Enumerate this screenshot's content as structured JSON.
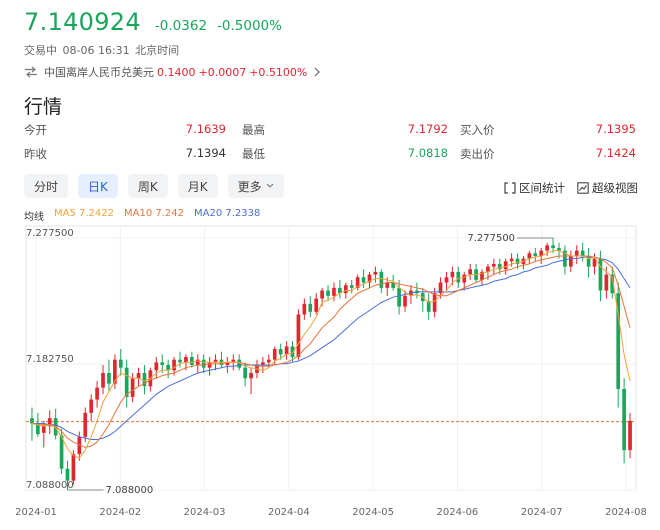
{
  "quote": {
    "price": "7.140924",
    "change": "-0.0362",
    "change_pct": "-0.5000%",
    "status": "交易中",
    "datetime": "08-06 16:31",
    "timezone": "北京时间"
  },
  "related": {
    "name": "中国离岸人民币兑美元",
    "price": "0.1400",
    "change": "+0.0007",
    "change_pct": "+0.5100%"
  },
  "section_title": "行情",
  "stats": [
    [
      {
        "label": "今开",
        "value": "7.1639",
        "color": "red"
      },
      {
        "label": "最高",
        "value": "7.1792",
        "color": "red"
      },
      {
        "label": "买入价",
        "value": "7.1395",
        "color": "red"
      }
    ],
    [
      {
        "label": "昨收",
        "value": "7.1394",
        "color": "plain"
      },
      {
        "label": "最低",
        "value": "7.0818",
        "color": "green"
      },
      {
        "label": "卖出价",
        "value": "7.1424",
        "color": "red"
      }
    ]
  ],
  "tabs": [
    {
      "label": "分时",
      "active": false
    },
    {
      "label": "日K",
      "active": true
    },
    {
      "label": "周K",
      "active": false
    },
    {
      "label": "月K",
      "active": false
    },
    {
      "label": "更多",
      "active": false
    }
  ],
  "tools": {
    "range_stats": "区间统计",
    "super_view": "超级视图"
  },
  "ma": {
    "label": "均线",
    "ma5": "MA5 7.2422",
    "ma10": "MA10 7.242",
    "ma20": "MA20 7.2338"
  },
  "colors": {
    "up": "#e0262e",
    "down": "#1aa65a",
    "ma5": "#f3a33b",
    "ma10": "#e8743b",
    "ma20": "#4c6fd9",
    "prev_close_line": "#e8743b"
  },
  "chart_data": {
    "type": "candlestick",
    "y_ticks": [
      "7.277500",
      "7.182750",
      "7.088000"
    ],
    "ylim": [
      7.088,
      7.2775
    ],
    "x_ticks": [
      "2024-01",
      "2024-02",
      "2024-03",
      "2024-04",
      "2024-05",
      "2024-06",
      "2024-07",
      "2024-08"
    ],
    "max_annotation": "7.277500",
    "min_annotation": "7.088000",
    "prev_close": 7.1394,
    "candles": [
      [
        7.142,
        7.15,
        7.125,
        7.138
      ],
      [
        7.138,
        7.146,
        7.128,
        7.13
      ],
      [
        7.131,
        7.14,
        7.12,
        7.136
      ],
      [
        7.136,
        7.148,
        7.13,
        7.142
      ],
      [
        7.142,
        7.149,
        7.126,
        7.129
      ],
      [
        7.129,
        7.134,
        7.1,
        7.104
      ],
      [
        7.104,
        7.11,
        7.088,
        7.095
      ],
      [
        7.095,
        7.118,
        7.092,
        7.115
      ],
      [
        7.115,
        7.132,
        7.11,
        7.128
      ],
      [
        7.128,
        7.15,
        7.124,
        7.146
      ],
      [
        7.146,
        7.16,
        7.14,
        7.156
      ],
      [
        7.156,
        7.17,
        7.15,
        7.165
      ],
      [
        7.165,
        7.182,
        7.16,
        7.176
      ],
      [
        7.176,
        7.186,
        7.162,
        7.168
      ],
      [
        7.168,
        7.19,
        7.164,
        7.186
      ],
      [
        7.186,
        7.194,
        7.174,
        7.18
      ],
      [
        7.18,
        7.186,
        7.15,
        7.158
      ],
      [
        7.158,
        7.176,
        7.154,
        7.172
      ],
      [
        7.172,
        7.18,
        7.166,
        7.176
      ],
      [
        7.176,
        7.182,
        7.16,
        7.166
      ],
      [
        7.166,
        7.18,
        7.162,
        7.178
      ],
      [
        7.178,
        7.188,
        7.172,
        7.184
      ],
      [
        7.184,
        7.19,
        7.176,
        7.182
      ],
      [
        7.182,
        7.186,
        7.172,
        7.178
      ],
      [
        7.178,
        7.188,
        7.174,
        7.186
      ],
      [
        7.186,
        7.192,
        7.18,
        7.184
      ],
      [
        7.184,
        7.19,
        7.178,
        7.188
      ],
      [
        7.188,
        7.192,
        7.18,
        7.182
      ],
      [
        7.182,
        7.19,
        7.176,
        7.186
      ],
      [
        7.186,
        7.19,
        7.176,
        7.18
      ],
      [
        7.18,
        7.188,
        7.174,
        7.184
      ],
      [
        7.184,
        7.19,
        7.178,
        7.186
      ],
      [
        7.186,
        7.192,
        7.18,
        7.182
      ],
      [
        7.182,
        7.188,
        7.176,
        7.184
      ],
      [
        7.184,
        7.19,
        7.178,
        7.186
      ],
      [
        7.186,
        7.19,
        7.178,
        7.18
      ],
      [
        7.18,
        7.184,
        7.166,
        7.172
      ],
      [
        7.172,
        7.18,
        7.16,
        7.176
      ],
      [
        7.176,
        7.186,
        7.172,
        7.182
      ],
      [
        7.182,
        7.188,
        7.176,
        7.184
      ],
      [
        7.184,
        7.19,
        7.18,
        7.186
      ],
      [
        7.186,
        7.196,
        7.182,
        7.194
      ],
      [
        7.194,
        7.198,
        7.186,
        7.19
      ],
      [
        7.19,
        7.2,
        7.186,
        7.196
      ],
      [
        7.196,
        7.2,
        7.184,
        7.188
      ],
      [
        7.188,
        7.224,
        7.186,
        7.22
      ],
      [
        7.22,
        7.232,
        7.216,
        7.228
      ],
      [
        7.228,
        7.234,
        7.218,
        7.222
      ],
      [
        7.222,
        7.236,
        7.22,
        7.232
      ],
      [
        7.232,
        7.24,
        7.226,
        7.238
      ],
      [
        7.238,
        7.242,
        7.23,
        7.234
      ],
      [
        7.234,
        7.244,
        7.23,
        7.24
      ],
      [
        7.24,
        7.246,
        7.232,
        7.236
      ],
      [
        7.236,
        7.244,
        7.232,
        7.242
      ],
      [
        7.242,
        7.246,
        7.236,
        7.24
      ],
      [
        7.24,
        7.25,
        7.238,
        7.248
      ],
      [
        7.248,
        7.254,
        7.24,
        7.244
      ],
      [
        7.244,
        7.252,
        7.24,
        7.25
      ],
      [
        7.25,
        7.256,
        7.244,
        7.252
      ],
      [
        7.252,
        7.254,
        7.236,
        7.24
      ],
      [
        7.24,
        7.248,
        7.234,
        7.244
      ],
      [
        7.244,
        7.25,
        7.238,
        7.24
      ],
      [
        7.24,
        7.246,
        7.22,
        7.226
      ],
      [
        7.226,
        7.238,
        7.222,
        7.234
      ],
      [
        7.234,
        7.242,
        7.228,
        7.238
      ],
      [
        7.238,
        7.244,
        7.232,
        7.236
      ],
      [
        7.236,
        7.24,
        7.222,
        7.23
      ],
      [
        7.23,
        7.236,
        7.216,
        7.222
      ],
      [
        7.222,
        7.24,
        7.218,
        7.236
      ],
      [
        7.236,
        7.248,
        7.232,
        7.244
      ],
      [
        7.244,
        7.252,
        7.238,
        7.248
      ],
      [
        7.248,
        7.256,
        7.242,
        7.252
      ],
      [
        7.252,
        7.256,
        7.24,
        7.244
      ],
      [
        7.244,
        7.252,
        7.238,
        7.25
      ],
      [
        7.25,
        7.258,
        7.246,
        7.254
      ],
      [
        7.254,
        7.258,
        7.244,
        7.246
      ],
      [
        7.246,
        7.254,
        7.242,
        7.252
      ],
      [
        7.252,
        7.258,
        7.246,
        7.256
      ],
      [
        7.256,
        7.262,
        7.25,
        7.258
      ],
      [
        7.258,
        7.262,
        7.25,
        7.254
      ],
      [
        7.254,
        7.262,
        7.25,
        7.26
      ],
      [
        7.26,
        7.266,
        7.256,
        7.262
      ],
      [
        7.262,
        7.266,
        7.254,
        7.258
      ],
      [
        7.258,
        7.264,
        7.254,
        7.262
      ],
      [
        7.262,
        7.268,
        7.258,
        7.266
      ],
      [
        7.266,
        7.27,
        7.26,
        7.264
      ],
      [
        7.264,
        7.27,
        7.258,
        7.268
      ],
      [
        7.268,
        7.274,
        7.264,
        7.272
      ],
      [
        7.272,
        7.2775,
        7.266,
        7.27
      ],
      [
        7.27,
        7.274,
        7.262,
        7.268
      ],
      [
        7.268,
        7.272,
        7.25,
        7.256
      ],
      [
        7.256,
        7.268,
        7.252,
        7.264
      ],
      [
        7.264,
        7.272,
        7.258,
        7.268
      ],
      [
        7.268,
        7.274,
        7.26,
        7.264
      ],
      [
        7.264,
        7.27,
        7.248,
        7.256
      ],
      [
        7.256,
        7.266,
        7.25,
        7.262
      ],
      [
        7.262,
        7.268,
        7.23,
        7.238
      ],
      [
        7.238,
        7.256,
        7.232,
        7.25
      ],
      [
        7.25,
        7.256,
        7.232,
        7.236
      ],
      [
        7.236,
        7.244,
        7.15,
        7.164
      ],
      [
        7.164,
        7.172,
        7.108,
        7.118
      ],
      [
        7.118,
        7.146,
        7.112,
        7.14
      ]
    ],
    "ma5": [
      7.138,
      7.137,
      7.136,
      7.137,
      7.135,
      7.128,
      7.119,
      7.114,
      7.112,
      7.118,
      7.128,
      7.14,
      7.154,
      7.162,
      7.17,
      7.176,
      7.174,
      7.172,
      7.172,
      7.17,
      7.172,
      7.176,
      7.178,
      7.178,
      7.18,
      7.183,
      7.184,
      7.184,
      7.185,
      7.184,
      7.184,
      7.184,
      7.184,
      7.184,
      7.184,
      7.184,
      7.181,
      7.18,
      7.179,
      7.178,
      7.18,
      7.185,
      7.187,
      7.19,
      7.191,
      7.198,
      7.205,
      7.211,
      7.218,
      7.229,
      7.231,
      7.233,
      7.236,
      7.238,
      7.238,
      7.241,
      7.243,
      7.245,
      7.247,
      7.247,
      7.246,
      7.245,
      7.24,
      7.237,
      7.234,
      7.235,
      7.233,
      7.229,
      7.23,
      7.234,
      7.238,
      7.244,
      7.247,
      7.248,
      7.25,
      7.25,
      7.251,
      7.252,
      7.254,
      7.255,
      7.256,
      7.258,
      7.259,
      7.26,
      7.262,
      7.263,
      7.264,
      7.266,
      7.268,
      7.268,
      7.266,
      7.264,
      7.264,
      7.264,
      7.262,
      7.263,
      7.256,
      7.252,
      7.248,
      7.22,
      7.19,
      7.17
    ],
    "ma10": [
      7.138,
      7.137,
      7.137,
      7.137,
      7.136,
      7.132,
      7.127,
      7.124,
      7.122,
      7.12,
      7.121,
      7.124,
      7.13,
      7.137,
      7.146,
      7.154,
      7.16,
      7.163,
      7.166,
      7.168,
      7.171,
      7.172,
      7.174,
      7.175,
      7.176,
      7.178,
      7.18,
      7.181,
      7.182,
      7.182,
      7.183,
      7.183,
      7.183,
      7.184,
      7.184,
      7.184,
      7.183,
      7.182,
      7.181,
      7.181,
      7.181,
      7.182,
      7.183,
      7.184,
      7.186,
      7.189,
      7.194,
      7.198,
      7.204,
      7.21,
      7.214,
      7.218,
      7.224,
      7.228,
      7.232,
      7.236,
      7.238,
      7.24,
      7.242,
      7.243,
      7.244,
      7.244,
      7.243,
      7.242,
      7.241,
      7.24,
      7.239,
      7.237,
      7.235,
      7.234,
      7.234,
      7.236,
      7.238,
      7.24,
      7.242,
      7.244,
      7.246,
      7.248,
      7.25,
      7.252,
      7.253,
      7.254,
      7.256,
      7.257,
      7.258,
      7.26,
      7.261,
      7.262,
      7.263,
      7.264,
      7.264,
      7.264,
      7.264,
      7.264,
      7.264,
      7.263,
      7.262,
      7.259,
      7.255,
      7.242,
      7.226,
      7.21
    ],
    "ma20": [
      7.138,
      7.138,
      7.138,
      7.137,
      7.137,
      7.135,
      7.132,
      7.13,
      7.128,
      7.127,
      7.126,
      7.126,
      7.127,
      7.129,
      7.132,
      7.136,
      7.14,
      7.144,
      7.148,
      7.152,
      7.156,
      7.16,
      7.163,
      7.166,
      7.168,
      7.17,
      7.172,
      7.174,
      7.176,
      7.177,
      7.178,
      7.179,
      7.18,
      7.181,
      7.181,
      7.182,
      7.182,
      7.182,
      7.182,
      7.182,
      7.182,
      7.182,
      7.183,
      7.183,
      7.184,
      7.185,
      7.187,
      7.189,
      7.192,
      7.195,
      7.198,
      7.201,
      7.205,
      7.209,
      7.213,
      7.217,
      7.22,
      7.223,
      7.226,
      7.229,
      7.231,
      7.233,
      7.234,
      7.235,
      7.236,
      7.237,
      7.237,
      7.237,
      7.237,
      7.237,
      7.237,
      7.237,
      7.238,
      7.239,
      7.24,
      7.241,
      7.242,
      7.243,
      7.245,
      7.246,
      7.247,
      7.249,
      7.25,
      7.252,
      7.253,
      7.255,
      7.256,
      7.257,
      7.259,
      7.26,
      7.261,
      7.262,
      7.262,
      7.263,
      7.263,
      7.263,
      7.262,
      7.261,
      7.259,
      7.254,
      7.247,
      7.24
    ]
  }
}
